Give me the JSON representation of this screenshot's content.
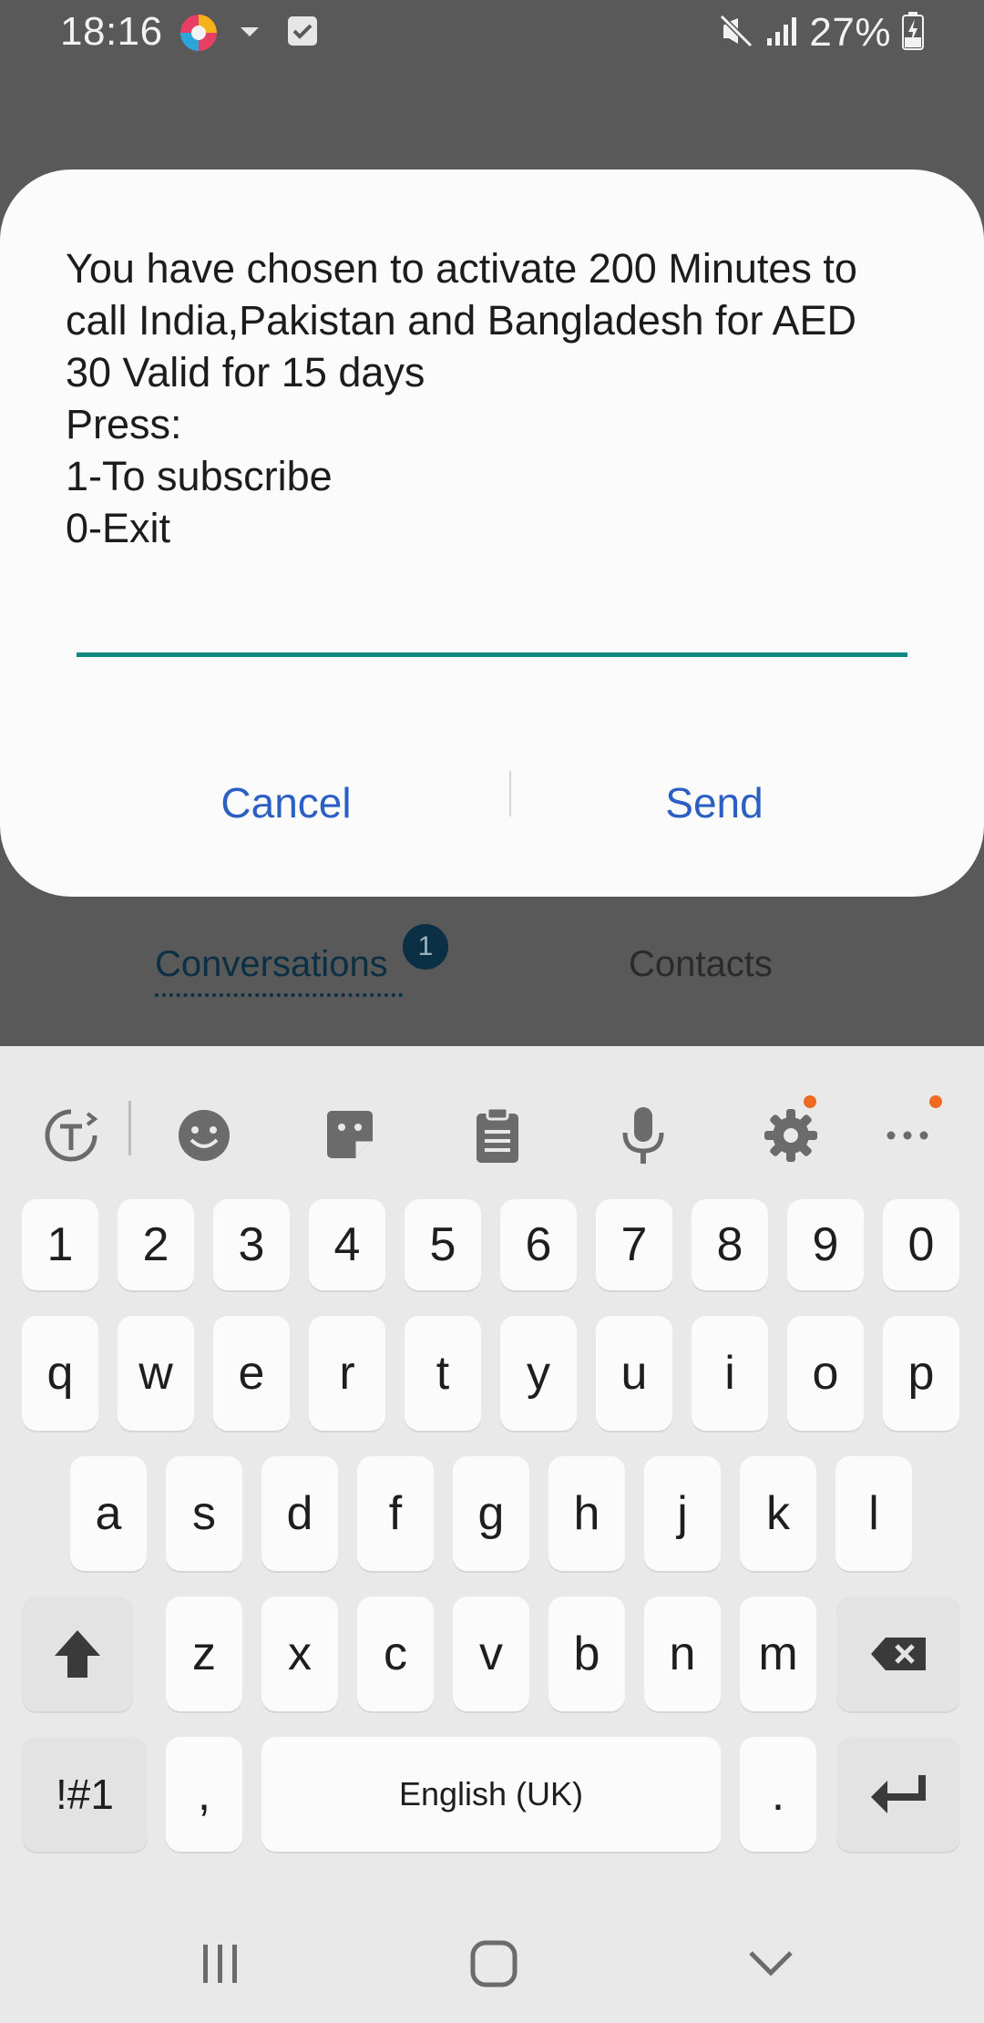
{
  "status_bar": {
    "time": "18:16",
    "battery_percent": "27%",
    "icons": [
      "browser-app-icon",
      "caret-down-icon",
      "checkbox-icon",
      "mute-icon",
      "signal-icon",
      "battery-charging-icon"
    ]
  },
  "background_app": {
    "tabs": [
      {
        "label": "Conversations",
        "badge": "1",
        "active": true
      },
      {
        "label": "Contacts",
        "active": false
      }
    ]
  },
  "dialog": {
    "message": "You have chosen to activate 200 Minutes to\ncall India,Pakistan and Bangladesh for AED\n30 Valid for 15 days\nPress:\n1-To subscribe\n0-Exit",
    "input_value": "",
    "cancel_label": "Cancel",
    "send_label": "Send",
    "accent_color": "#138a7f",
    "button_color": "#2c5fc4"
  },
  "keyboard": {
    "toolbar": [
      "translate-icon",
      "emoji-icon",
      "sticker-icon",
      "clipboard-icon",
      "microphone-icon",
      "settings-icon",
      "more-icon"
    ],
    "rows": {
      "numbers": [
        "1",
        "2",
        "3",
        "4",
        "5",
        "6",
        "7",
        "8",
        "9",
        "0"
      ],
      "row1": [
        "q",
        "w",
        "e",
        "r",
        "t",
        "y",
        "u",
        "i",
        "o",
        "p"
      ],
      "row2": [
        "a",
        "s",
        "d",
        "f",
        "g",
        "h",
        "j",
        "k",
        "l"
      ],
      "row3": [
        "z",
        "x",
        "c",
        "v",
        "b",
        "n",
        "m"
      ]
    },
    "symbols_label": "!#1",
    "comma_label": ",",
    "space_label": "English (UK)",
    "period_label": "."
  },
  "nav_bar": [
    "recent-apps-icon",
    "home-icon",
    "back-icon"
  ]
}
